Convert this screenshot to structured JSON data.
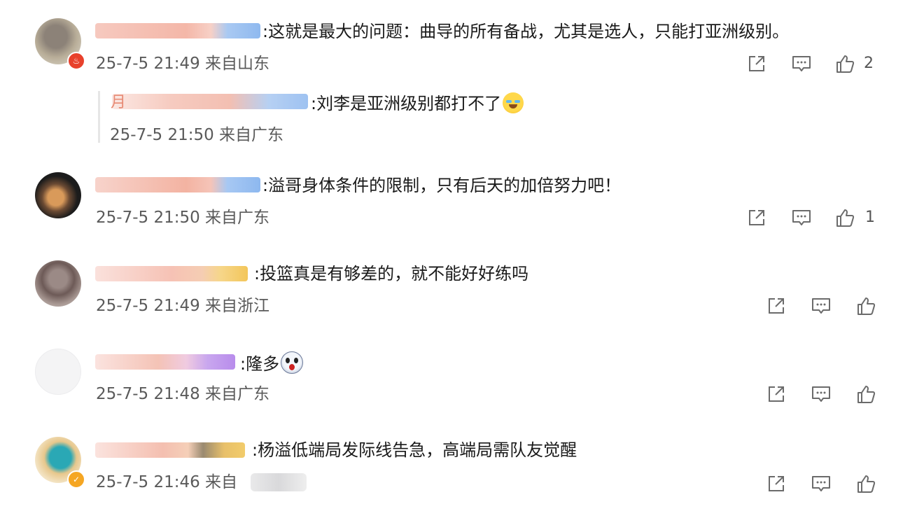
{
  "comments": [
    {
      "text": ":这就是最大的问题：曲导的所有备战，尤其是选人，只能打亚洲级别。",
      "meta": "25-7-5 21:49 来自山东",
      "likes": "2",
      "reply": {
        "name_char": "月",
        "text": ":刘李是亚洲级别都打不了",
        "meta": "25-7-5 21:50 来自广东"
      }
    },
    {
      "text": ":溢哥身体条件的限制，只有后天的加倍努力吧！",
      "meta": "25-7-5 21:50 来自广东",
      "likes": "1"
    },
    {
      "text": ":投篮真是有够差的，就不能好好练吗",
      "meta": "25-7-5 21:49 来自浙江"
    },
    {
      "text": ":隆多",
      "meta": "25-7-5 21:48 来自广东"
    },
    {
      "text": ":杨溢低端局发际线告急，高端局需队友觉醒",
      "meta": "25-7-5 21:46 来自"
    }
  ],
  "icons": {
    "share": "share-icon",
    "comment": "comment-icon",
    "like": "thumbs-up-icon",
    "vip_badge": "vip-badge-icon",
    "verified_badge": "verified-badge-icon",
    "emoji_laugh_cry": "laugh-cry-emoji-icon",
    "emoji_shocked": "shocked-emoji-icon"
  },
  "colors": {
    "text": "#1a1a1a",
    "meta": "#5a5a5a",
    "icon": "#6b6b6b",
    "vip_badge": "#e8412c",
    "verified_badge": "#f5a623"
  }
}
